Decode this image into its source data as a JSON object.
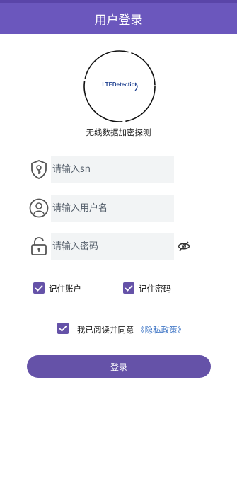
{
  "header": {
    "title": "用户登录"
  },
  "logo": {
    "text": "LTEDetectior"
  },
  "app": {
    "subtitle": "无线数据加密探测"
  },
  "form": {
    "sn_placeholder": "请输入sn",
    "username_placeholder": "请输入用户名",
    "password_placeholder": "请输入密码"
  },
  "options": {
    "remember_account": {
      "label": "记住账户",
      "checked": true
    },
    "remember_password": {
      "label": "记住密码",
      "checked": true
    }
  },
  "agreement": {
    "text": "我已阅读并同意",
    "link": "《隐私政策》",
    "checked": true
  },
  "login_button": "登录",
  "colors": {
    "primary": "#6b57bd",
    "button": "#6552a8",
    "link": "#3b73c4",
    "field_bg": "#f2f4f5"
  }
}
